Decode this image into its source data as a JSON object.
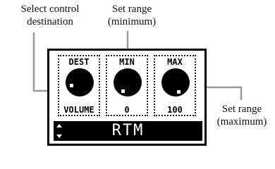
{
  "annotations": {
    "select_control_destination": [
      "Select control",
      "destination"
    ],
    "set_range_minimum": [
      "Set range",
      "(minimum)"
    ],
    "set_range_maximum": [
      "Set range",
      "(maximum)"
    ]
  },
  "screen": {
    "knobs": [
      {
        "label": "DEST",
        "value": "VOLUME"
      },
      {
        "label": "MIN",
        "value": "0"
      },
      {
        "label": "MAX",
        "value": "100"
      }
    ],
    "patch_name": "RTM"
  }
}
